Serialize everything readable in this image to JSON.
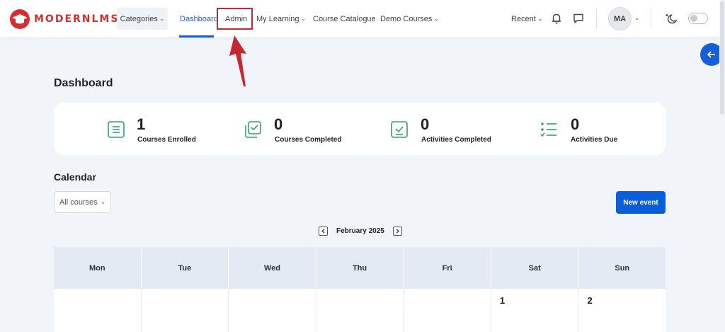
{
  "brand": {
    "name": "MODERNLMS"
  },
  "nav": {
    "categories": "Categories",
    "dashboard": "Dashboard",
    "admin": "Admin",
    "my_learning": "My Learning",
    "catalogue": "Course Catalogue",
    "demo_courses": "Demo Courses",
    "recent": "Recent"
  },
  "user": {
    "initials": "MA"
  },
  "page": {
    "title": "Dashboard"
  },
  "stats": [
    {
      "value": "1",
      "label": "Courses Enrolled",
      "icon": "clipboard-list-icon"
    },
    {
      "value": "0",
      "label": "Courses Completed",
      "icon": "stacked-check-icon"
    },
    {
      "value": "0",
      "label": "Activities Completed",
      "icon": "clipboard-check-icon"
    },
    {
      "value": "0",
      "label": "Activities Due",
      "icon": "checklist-icon"
    }
  ],
  "calendar": {
    "title": "Calendar",
    "course_filter": "All courses",
    "new_event": "New event",
    "month": "February 2025",
    "days": [
      "Mon",
      "Tue",
      "Wed",
      "Thu",
      "Fri",
      "Sat",
      "Sun"
    ],
    "first_week": [
      "",
      "",
      "",
      "",
      "",
      "1",
      "2"
    ]
  },
  "colors": {
    "accent": "#1560d8",
    "brand": "#d32f2f",
    "stat_icon": "#2fa36b",
    "annotation": "#c62833"
  }
}
